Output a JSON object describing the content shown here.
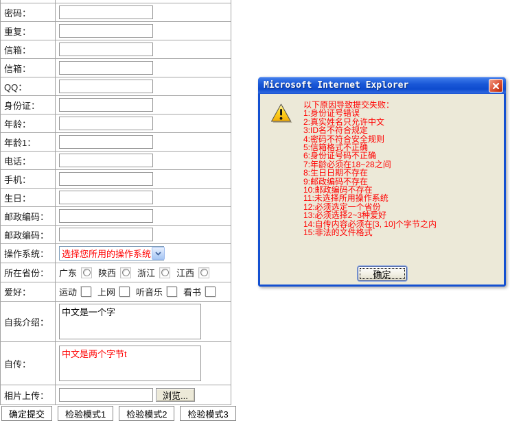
{
  "form": {
    "text_rows": [
      {
        "label": "密码："
      },
      {
        "label": "重复："
      },
      {
        "label": "信箱："
      },
      {
        "label": "信箱："
      },
      {
        "label": "QQ："
      },
      {
        "label": "身份证："
      },
      {
        "label": "年龄："
      },
      {
        "label": "年龄1："
      },
      {
        "label": "电话："
      },
      {
        "label": "手机："
      },
      {
        "label": "生日："
      },
      {
        "label": "邮政编码："
      },
      {
        "label": "邮政编码："
      }
    ],
    "os": {
      "label": "操作系统：",
      "selected": "选择您所用的操作系统"
    },
    "province": {
      "label": "所在省份：",
      "options": [
        "广东",
        "陕西",
        "浙江",
        "江西"
      ]
    },
    "hobby": {
      "label": "爱好：",
      "options": [
        "运动",
        "上网",
        "听音乐",
        "看书"
      ]
    },
    "intro": {
      "label": "自我介绍：",
      "value": "中文是一个字"
    },
    "bio": {
      "label": "自传：",
      "value": "中文是两个字节t",
      "color": "#ff0000"
    },
    "photo": {
      "label": "相片上传：",
      "browse_label": "浏览..."
    },
    "buttons": [
      "确定提交",
      "检验模式1",
      "检验模式2",
      "检验模式3"
    ]
  },
  "dialog": {
    "title": "Microsoft Internet Explorer",
    "messages": [
      "以下原因导致提交失败：",
      "1:身份证号错误",
      "2:真实姓名只允许中文",
      "3:ID名不符合规定",
      "4:密码不符合安全规则",
      "5:信箱格式不正确",
      "6:身份证号码不正确",
      "7:年龄必须在18~28之间",
      "8:生日日期不存在",
      "9:邮政编码不存在",
      "10:邮政编码不存在",
      "11:未选择所用操作系统",
      "12:必须选定一个省份",
      "13:必须选择2~3种爱好",
      "14:自传内容必须在[3, 10]个字节之内",
      "15:非法的文件格式"
    ],
    "ok_label": "确定",
    "colors": {
      "message": "#ff0000",
      "content_bg": "#ece9d8",
      "titlebar": "#1450d1"
    }
  }
}
